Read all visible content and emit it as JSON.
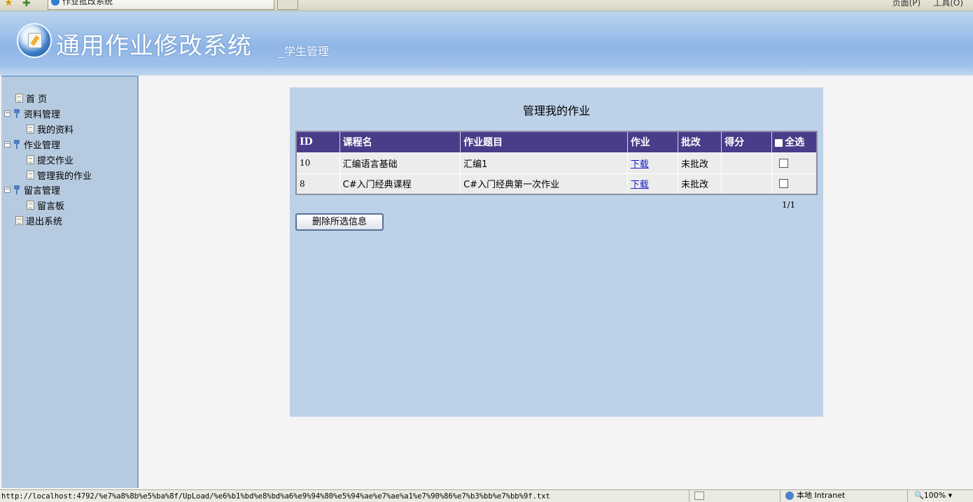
{
  "browser": {
    "tab_title": "作业批改系统",
    "tools": [
      "页面(P)",
      "工具(O)"
    ]
  },
  "banner": {
    "title": "通用作业修改系统",
    "subtitle": "_学生管理"
  },
  "sidebar": {
    "items": [
      {
        "label": "首 页",
        "type": "page",
        "level": 0
      },
      {
        "label": "资料管理",
        "type": "folder",
        "level": 0,
        "expanded": true
      },
      {
        "label": "我的资料",
        "type": "page",
        "level": 1
      },
      {
        "label": "作业管理",
        "type": "folder",
        "level": 0,
        "expanded": true
      },
      {
        "label": "提交作业",
        "type": "page",
        "level": 1
      },
      {
        "label": "管理我的作业",
        "type": "page",
        "level": 1
      },
      {
        "label": "留言管理",
        "type": "folder",
        "level": 0,
        "expanded": true
      },
      {
        "label": "留言板",
        "type": "page",
        "level": 1
      },
      {
        "label": "退出系统",
        "type": "page",
        "level": 0
      }
    ]
  },
  "main": {
    "heading": "管理我的作业",
    "columns": [
      "ID",
      "课程名",
      "作业题目",
      "作业",
      "批改",
      "得分",
      "全选"
    ],
    "rows": [
      {
        "id": "10",
        "course": "汇编语言基础",
        "title": "汇编1",
        "download": "下载",
        "status": "未批改",
        "score": ""
      },
      {
        "id": "8",
        "course": "C#入门经典课程",
        "title": "C#入门经典第一次作业",
        "download": "下载",
        "status": "未批改",
        "score": ""
      }
    ],
    "pager": "1/1",
    "delete_button": "删除所选信息"
  },
  "statusbar": {
    "url": "http://localhost:4792/%e7%a8%8b%e5%ba%8f/UpLoad/%e6%b1%bd%e8%bd%a6%e9%94%80%e5%94%ae%e7%ae%a1%e7%90%86%e7%b3%bb%e7%bb%9f.txt",
    "zone": "本地 Intranet",
    "zoom": "100%"
  }
}
